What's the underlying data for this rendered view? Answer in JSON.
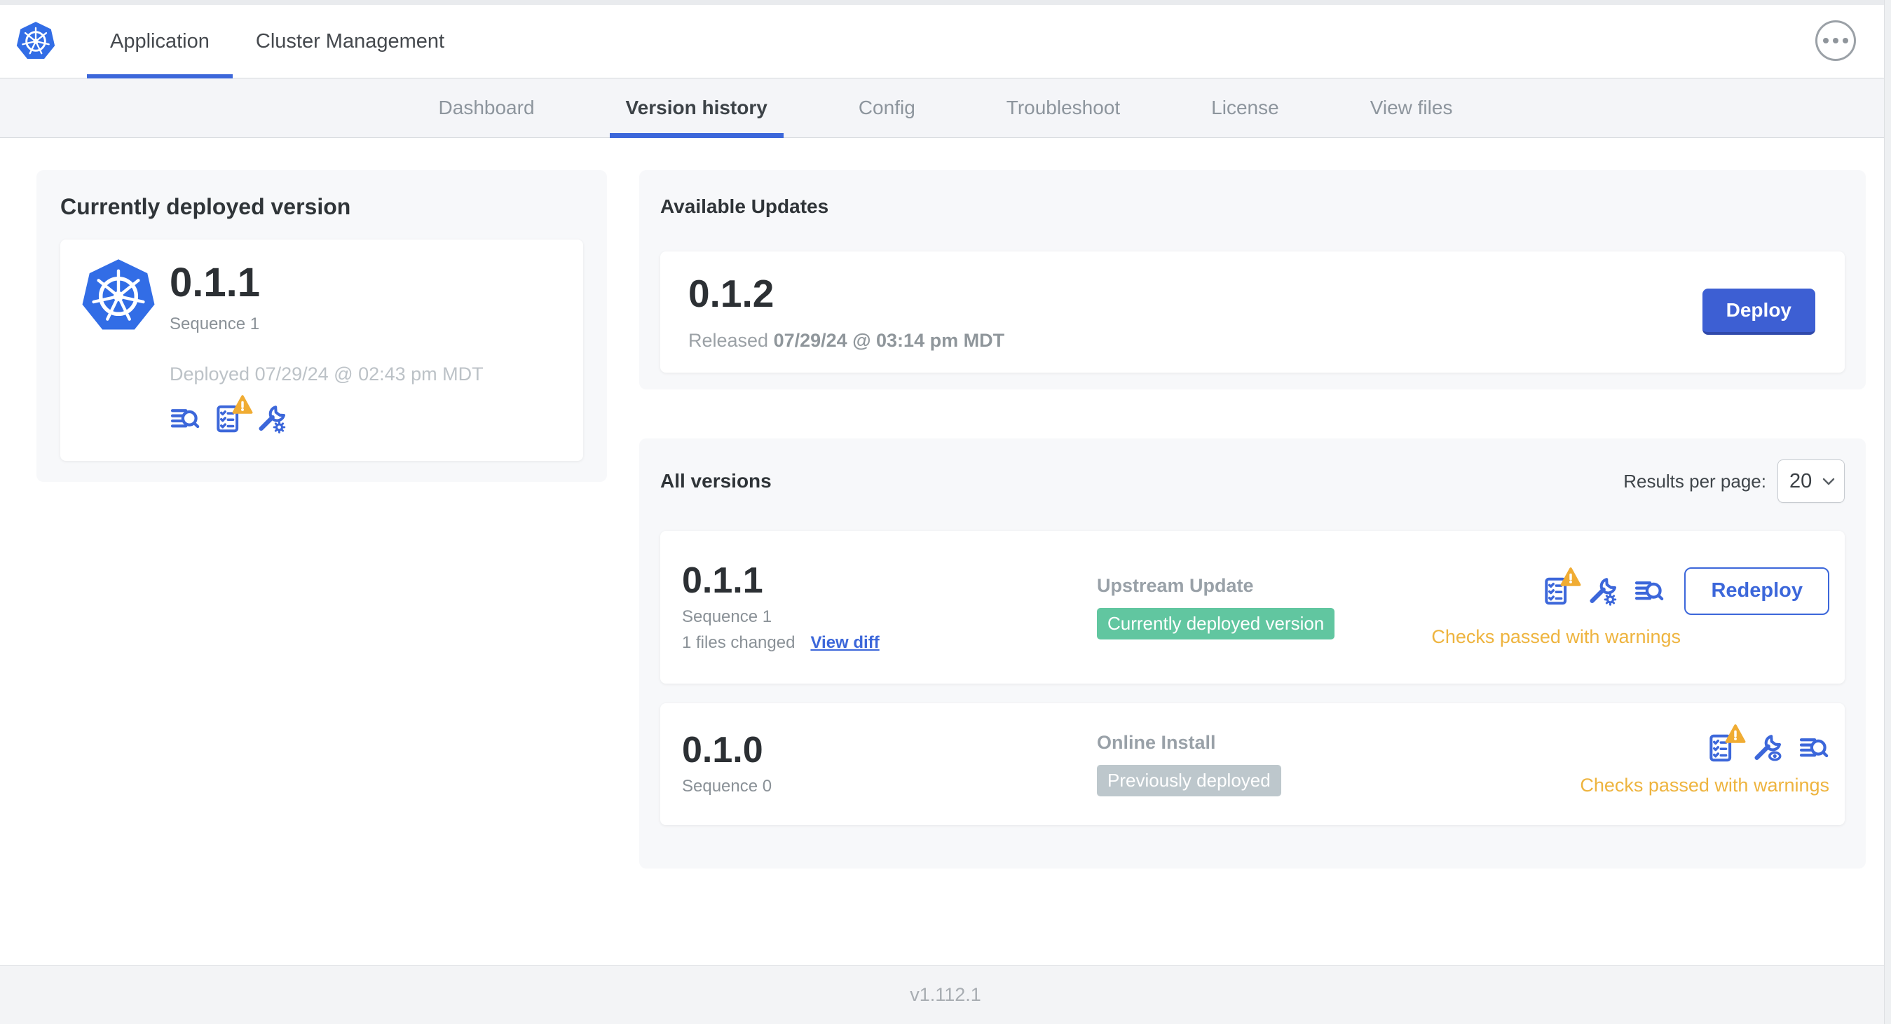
{
  "topbar": {
    "tabs": [
      {
        "label": "Application"
      },
      {
        "label": "Cluster Management"
      }
    ]
  },
  "subnav": {
    "tabs": [
      "Dashboard",
      "Version history",
      "Config",
      "Troubleshoot",
      "License",
      "View files"
    ],
    "active": "Version history"
  },
  "current_version_card": {
    "title": "Currently deployed version",
    "version": "0.1.1",
    "sequence": "Sequence 1",
    "deployed_at": "Deployed 07/29/24 @ 02:43 pm MDT",
    "icons": [
      "release-notes-icon",
      "preflight-checks-warning-icon",
      "config-icon"
    ]
  },
  "available_updates": {
    "title": "Available Updates",
    "version": "0.1.2",
    "released_prefix": "Released",
    "released_at": "07/29/24 @ 03:14 pm MDT",
    "deploy_label": "Deploy"
  },
  "all_versions": {
    "title": "All versions",
    "results_per_page_label": "Results per page:",
    "results_per_page_value": "20",
    "rows": [
      {
        "version": "0.1.1",
        "sequence": "Sequence 1",
        "files_changed": "1 files changed",
        "view_diff_label": "View diff",
        "source": "Upstream Update",
        "status_badge": "Currently deployed version",
        "checks_status": "Checks passed with warnings",
        "action_label": "Redeploy",
        "icons": [
          "preflight-checks-warning-icon",
          "config-icon",
          "release-notes-icon"
        ]
      },
      {
        "version": "0.1.0",
        "sequence": "Sequence 0",
        "source": "Online Install",
        "status_badge": "Previously deployed",
        "checks_status": "Checks passed with warnings",
        "icons": [
          "preflight-checks-warning-icon",
          "config-diff-icon",
          "release-notes-icon"
        ]
      }
    ]
  },
  "footer": {
    "app_version": "v1.112.1"
  },
  "colors": {
    "accent_blue": "#3c67da",
    "kubernetes_blue": "#326de6",
    "warning_orange": "#eeb43f",
    "badge_green": "#61c6a0",
    "badge_gray": "#bdc7cc",
    "deploy_button_blue": "#3d5fd3"
  }
}
